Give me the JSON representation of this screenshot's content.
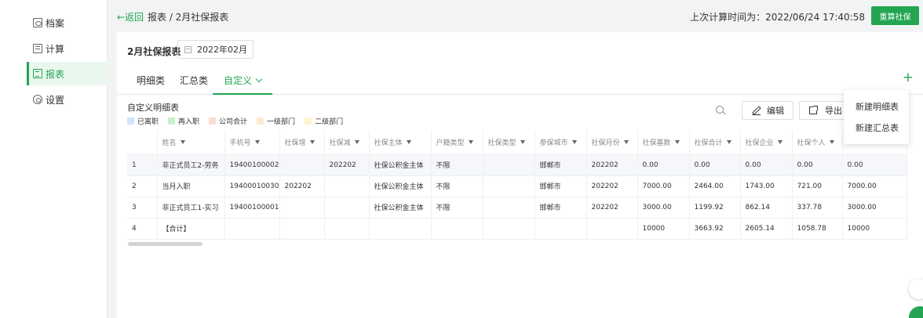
{
  "sidebar": {
    "items": [
      {
        "label": "档案",
        "icon": "archive-icon"
      },
      {
        "label": "计算",
        "icon": "calculator-icon"
      },
      {
        "label": "报表",
        "icon": "report-icon",
        "active": true
      },
      {
        "label": "设置",
        "icon": "gear-icon"
      }
    ]
  },
  "header": {
    "back": "←返回",
    "breadcrumb": "报表 / 2月社保报表",
    "last_calc": "上次计算时间为：2022/06/24 17:40:58",
    "reset_button": "重算社保"
  },
  "main": {
    "report_title": "2月社保报表",
    "month": "2022年02月",
    "tabs": [
      {
        "label": "明细类"
      },
      {
        "label": "汇总类"
      },
      {
        "label": "自定义",
        "active": true
      }
    ],
    "add_symbol": "+",
    "section_title": "自定义明细表",
    "legend": [
      {
        "label": "已离职",
        "color": "#cfe6fb"
      },
      {
        "label": "再入职",
        "color": "#c6f0cd"
      },
      {
        "label": "公司合计",
        "color": "#fbdcd5"
      },
      {
        "label": "一级部门",
        "color": "#fdebcf"
      },
      {
        "label": "二级部门",
        "color": "#fdf5cd"
      }
    ],
    "edit_button": "编辑",
    "export_button": "导出",
    "dropdown": [
      "新建明细表",
      "新建汇总表"
    ]
  },
  "table": {
    "columns": [
      "",
      "姓名",
      "手机号",
      "社保增",
      "社保减",
      "社保主体",
      "户籍类型",
      "社保类型",
      "参保城市",
      "社保月份",
      "社保基数",
      "社保合计",
      "社保企业",
      "社保个人",
      ""
    ],
    "rows": [
      [
        "1",
        "非正式员工2-劳务",
        "19400100002",
        "",
        "202202",
        "社保公积金主体",
        "不限",
        "",
        "邯郸市",
        "202202",
        "0.00",
        "0.00",
        "0.00",
        "0.00",
        "0.00"
      ],
      [
        "2",
        "当月入职",
        "19400010030",
        "202202",
        "",
        "社保公积金主体",
        "不限",
        "",
        "邯郸市",
        "202202",
        "7000.00",
        "2464.00",
        "1743.00",
        "721.00",
        "7000.00"
      ],
      [
        "3",
        "非正式员工1-实习",
        "19400100001",
        "",
        "",
        "社保公积金主体",
        "不限",
        "",
        "邯郸市",
        "202202",
        "3000.00",
        "1199.92",
        "862.14",
        "337.78",
        "3000.00"
      ],
      [
        "4",
        "【合计】",
        "",
        "",
        "",
        "",
        "",
        "",
        "",
        "",
        "10000",
        "3663.92",
        "2605.14",
        "1058.78",
        "10000"
      ]
    ]
  }
}
